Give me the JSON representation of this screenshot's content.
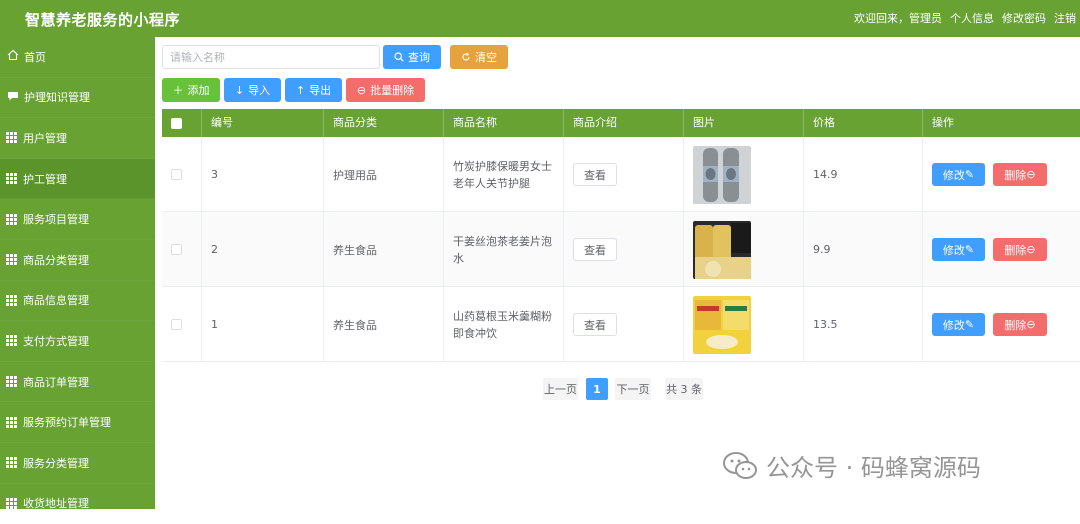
{
  "header": {
    "title": "智慧养老服务的小程序",
    "welcome": "欢迎回来，管理员",
    "profile": "个人信息",
    "password": "修改密码",
    "logout": "注销"
  },
  "sidebar": {
    "items": [
      {
        "label": "首页",
        "icon": "home-icon"
      },
      {
        "label": "护理知识管理",
        "icon": "chat-icon"
      },
      {
        "label": "用户管理",
        "icon": "grid-icon"
      },
      {
        "label": "护工管理",
        "icon": "grid-icon"
      },
      {
        "label": "服务项目管理",
        "icon": "grid-icon"
      },
      {
        "label": "商品分类管理",
        "icon": "grid-icon"
      },
      {
        "label": "商品信息管理",
        "icon": "grid-icon"
      },
      {
        "label": "支付方式管理",
        "icon": "grid-icon"
      },
      {
        "label": "商品订单管理",
        "icon": "grid-icon"
      },
      {
        "label": "服务预约订单管理",
        "icon": "grid-icon"
      },
      {
        "label": "服务分类管理",
        "icon": "grid-icon"
      },
      {
        "label": "收货地址管理",
        "icon": "grid-icon"
      }
    ]
  },
  "search": {
    "placeholder": "请输入名称",
    "query_label": "查询",
    "clear_label": "清空"
  },
  "toolbar": {
    "add_label": "添加",
    "import_label": "导入",
    "export_label": "导出",
    "batch_delete_label": "批量删除"
  },
  "table": {
    "columns": [
      "编号",
      "商品分类",
      "商品名称",
      "商品介绍",
      "图片",
      "价格",
      "操作"
    ],
    "view_label": "查看",
    "edit_label": "修改",
    "delete_label": "删除",
    "rows": [
      {
        "id": "3",
        "category": "护理用品",
        "name": "竹炭护膝保暖男女士老年人关节护腿",
        "price": "14.9"
      },
      {
        "id": "2",
        "category": "养生食品",
        "name": "干姜丝泡茶老姜片泡水",
        "price": "9.9"
      },
      {
        "id": "1",
        "category": "养生食品",
        "name": "山药葛根玉米羹糊粉即食冲饮",
        "price": "13.5"
      }
    ]
  },
  "pagination": {
    "prev_label": "上一页",
    "current_page": "1",
    "next_label": "下一页",
    "total_label": "共 3 条"
  },
  "watermark": {
    "text": "公众号 · 码蜂窝源码"
  },
  "colors": {
    "primary_green": "#67a233",
    "blue": "#409eff",
    "orange": "#e6a23c",
    "red": "#f56c6c",
    "success_green": "#67c23a"
  }
}
